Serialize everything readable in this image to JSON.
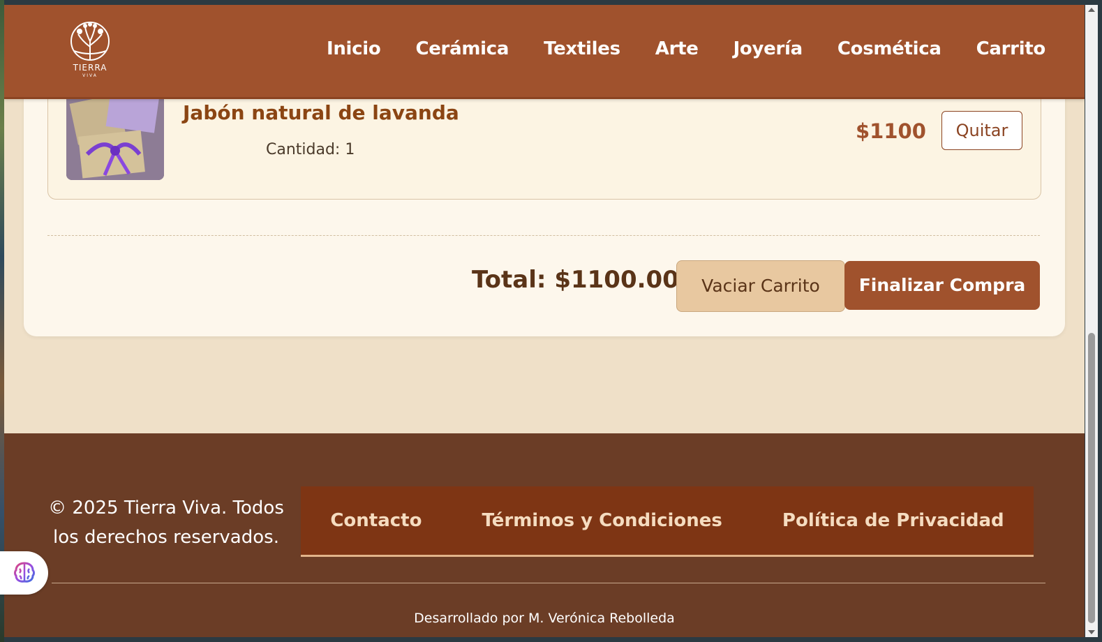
{
  "brand": {
    "name": "TIERRA",
    "sub": "VIVA"
  },
  "nav": {
    "items": [
      {
        "label": "Inicio"
      },
      {
        "label": "Cerámica"
      },
      {
        "label": "Textiles"
      },
      {
        "label": "Arte"
      },
      {
        "label": "Joyería"
      },
      {
        "label": "Cosmética"
      },
      {
        "label": "Carrito"
      }
    ]
  },
  "cart": {
    "items": [
      {
        "name": "Jabón natural de lavanda",
        "quantity": "Cantidad: 1",
        "price": "$1100",
        "remove_label": "Quitar"
      }
    ],
    "total": "Total: $1100.00",
    "empty_label": "Vaciar Carrito",
    "checkout_label": "Finalizar Compra"
  },
  "footer": {
    "copyright_line1": "© 2025 Tierra Viva. Todos",
    "copyright_line2": "los derechos reservados.",
    "links": [
      {
        "label": "Contacto"
      },
      {
        "label": "Términos y Condiciones"
      },
      {
        "label": "Política de Privacidad"
      }
    ],
    "credit": "Desarrollado por M. Verónica Rebolleda"
  },
  "colors": {
    "header": "#a0522d",
    "footer": "#6b3d26",
    "accent": "#8b4513"
  }
}
